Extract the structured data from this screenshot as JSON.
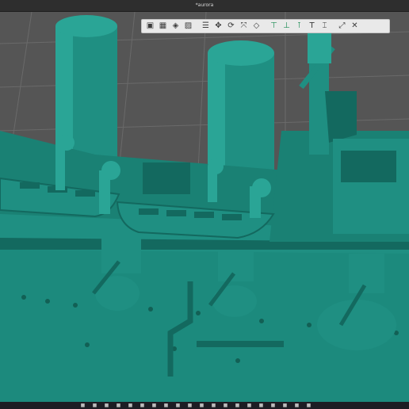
{
  "window": {
    "title": "*aurora"
  },
  "toolbar": {
    "buttons": [
      {
        "icon": "view-cube-icon",
        "glyph": "▣",
        "active": false
      },
      {
        "icon": "grid-icon",
        "glyph": "▦",
        "active": false
      },
      {
        "icon": "material-view-icon",
        "glyph": "◈",
        "active": false
      },
      {
        "icon": "image-icon",
        "glyph": "▨",
        "active": false
      },
      {
        "icon": "layers-icon",
        "glyph": "☰",
        "active": false
      },
      {
        "icon": "move-icon",
        "glyph": "✥",
        "active": false
      },
      {
        "icon": "rotate-icon",
        "glyph": "⟳",
        "active": false
      },
      {
        "icon": "scale-icon",
        "glyph": "⤧",
        "active": false
      },
      {
        "icon": "eraser-icon",
        "glyph": "◇",
        "active": false
      },
      {
        "icon": "support-add-icon",
        "glyph": "⊤",
        "active": true
      },
      {
        "icon": "support-edit-icon",
        "glyph": "⊥",
        "active": true
      },
      {
        "icon": "support-auto-icon",
        "glyph": "⊺",
        "active": true
      },
      {
        "icon": "text-tool-icon",
        "glyph": "T",
        "active": false
      },
      {
        "icon": "measure-icon",
        "glyph": "⌶",
        "active": false
      },
      {
        "icon": "fit-view-icon",
        "glyph": "⤢",
        "active": false
      },
      {
        "icon": "close-panel-icon",
        "glyph": "✕",
        "active": false
      }
    ]
  },
  "taskbar": {
    "icons": [
      "start-icon",
      "search-icon",
      "files-icon",
      "browser-icon",
      "mail-icon",
      "app-icon",
      "app-icon",
      "app-icon",
      "app-icon",
      "app-icon",
      "app-icon",
      "app-icon",
      "app-icon",
      "app-icon",
      "app-icon",
      "app-icon",
      "app-icon",
      "app-icon",
      "app-icon",
      "app-icon"
    ]
  },
  "colors": {
    "model": "#1f8f82",
    "model_shadow": "#13695f",
    "model_dark": "#0d4e47",
    "model_light": "#2aa596",
    "background": "#555555",
    "grid": "#6a6a6a",
    "toolbar_accent": "#1c8c54"
  }
}
